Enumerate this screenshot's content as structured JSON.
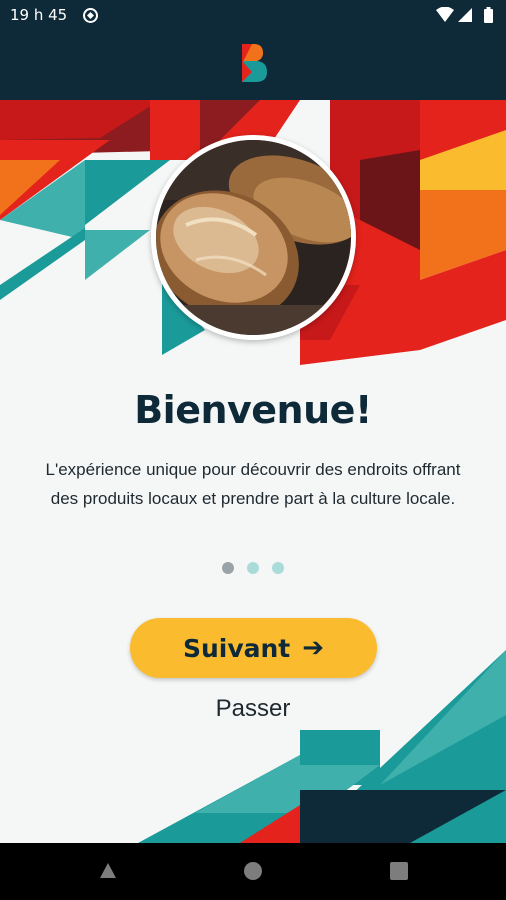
{
  "status_bar": {
    "time": "19 h 45"
  },
  "welcome": {
    "title": "Bienvenue!",
    "description": "L'expérience unique pour découvrir des endroits offrant des produits locaux et prendre part à la culture locale."
  },
  "pagination": {
    "current": 1,
    "total": 3
  },
  "actions": {
    "next_label": "Suivant",
    "skip_label": "Passer"
  },
  "icons": {
    "next": "arrow-right-icon",
    "status": [
      "sync-icon",
      "wifi-icon",
      "signal-icon",
      "battery-icon"
    ],
    "nav": [
      "back-icon",
      "home-icon",
      "recents-icon"
    ]
  },
  "colors": {
    "dark_navy": "#0e2a38",
    "red": "#e3231c",
    "dark_red": "#8c1c1f",
    "orange": "#f2721c",
    "yellow": "#fbbb2f",
    "teal": "#1b9a9a",
    "light_teal": "#3fb0ab",
    "background": "#f5f6f6",
    "dot_active": "#9aa3a8",
    "dot_inactive": "#a9dcd8"
  }
}
